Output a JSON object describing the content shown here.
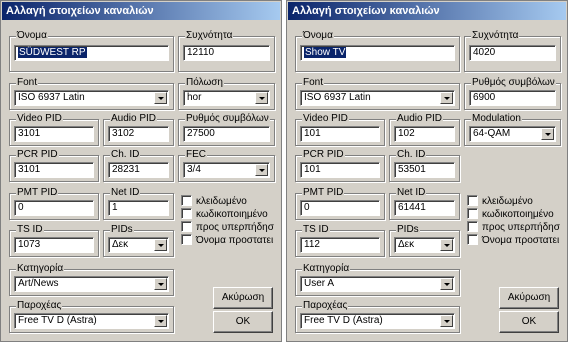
{
  "dialogs": [
    {
      "title": "Αλλαγή στοιχείων καναλιών",
      "name_label": "Όνομα",
      "name_value": "SÜDWEST RP",
      "freq_label": "Συχνότητα",
      "freq_value": "12110",
      "font_label": "Font",
      "font_value": "ISO 6937 Latin",
      "f2_label": "Πόλωση",
      "f2_value": "hor",
      "vpid_label": "Video PID",
      "vpid_value": "3101",
      "apid_label": "Audio PID",
      "apid_value": "3102",
      "f3_label": "Ρυθμός συμβόλων",
      "f3_value": "27500",
      "pcr_label": "PCR PID",
      "pcr_value": "3101",
      "chid_label": "Ch. ID",
      "chid_value": "28231",
      "f4_label": "FEC",
      "f4_value": "3/4",
      "pmt_label": "PMT PID",
      "pmt_value": "0",
      "netid_label": "Net ID",
      "netid_value": "1",
      "tsid_label": "TS ID",
      "tsid_value": "1073",
      "pids_label": "PIDs",
      "pids_value": "Δεκ",
      "cat_label": "Κατηγορία",
      "cat_value": "Art/News",
      "prov_label": "Παροχέας",
      "prov_value": "Free TV D (Astra)",
      "checkboxes": [
        "κλειδωμένο",
        "κωδικοποιημένο",
        "προς υπερπήδησ",
        "Όνομα προστατει"
      ],
      "cancel": "Ακύρωση",
      "ok": "OK"
    },
    {
      "title": "Αλλαγή στοιχείων καναλιών",
      "name_label": "Όνομα",
      "name_value": "Show TV",
      "freq_label": "Συχνότητα",
      "freq_value": "4020",
      "font_label": "Font",
      "font_value": "ISO 6937 Latin",
      "f2_label": "Ρυθμός συμβόλων",
      "f2_value": "6900",
      "vpid_label": "Video PID",
      "vpid_value": "101",
      "apid_label": "Audio PID",
      "apid_value": "102",
      "f3_label": "Modulation",
      "f3_value": "64-QAM",
      "pcr_label": "PCR PID",
      "pcr_value": "101",
      "chid_label": "Ch. ID",
      "chid_value": "53501",
      "pmt_label": "PMT PID",
      "pmt_value": "0",
      "netid_label": "Net ID",
      "netid_value": "61441",
      "tsid_label": "TS ID",
      "tsid_value": "112",
      "pids_label": "PIDs",
      "pids_value": "Δεκ",
      "cat_label": "Κατηγορία",
      "cat_value": "User A",
      "prov_label": "Παροχέας",
      "prov_value": "Free TV D (Astra)",
      "checkboxes": [
        "κλειδωμένο",
        "κωδικοποιημένο",
        "προς υπερπήδησ",
        "Όνομα προστατει"
      ],
      "cancel": "Ακύρωση",
      "ok": "OK"
    }
  ]
}
